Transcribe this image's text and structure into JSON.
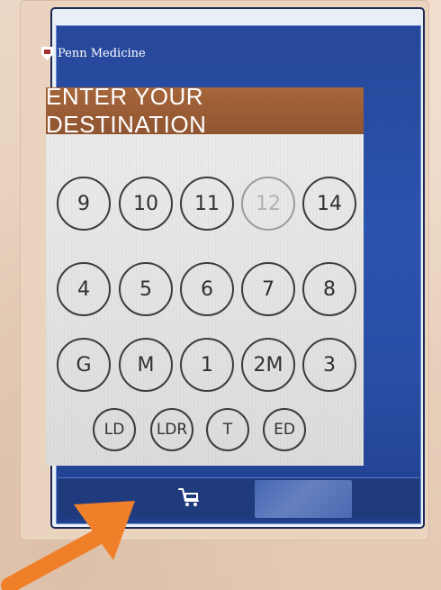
{
  "brand": {
    "name": "Penn Medicine",
    "logo_icon": "penn-shield-icon"
  },
  "header": {
    "title": "ENTER YOUR DESTINATION"
  },
  "keypad": {
    "rows": [
      [
        {
          "label": "9"
        },
        {
          "label": "10"
        },
        {
          "label": "11"
        },
        {
          "label": "12",
          "disabled": true
        },
        {
          "label": "14"
        }
      ],
      [
        {
          "label": "4"
        },
        {
          "label": "5"
        },
        {
          "label": "6"
        },
        {
          "label": "7"
        },
        {
          "label": "8"
        }
      ],
      [
        {
          "label": "G"
        },
        {
          "label": "M"
        },
        {
          "label": "1"
        },
        {
          "label": "2M"
        },
        {
          "label": "3"
        }
      ],
      [
        {
          "label": "LD"
        },
        {
          "label": "LDR"
        },
        {
          "label": "T"
        },
        {
          "label": "ED"
        }
      ]
    ]
  },
  "footer": {
    "cart_icon": "cart-icon"
  },
  "colors": {
    "frame_blue": "#2c53ad",
    "title_brown": "#9c5d35",
    "keypad_bg": "#e2e2e1",
    "arrow": "#f07f2a"
  }
}
